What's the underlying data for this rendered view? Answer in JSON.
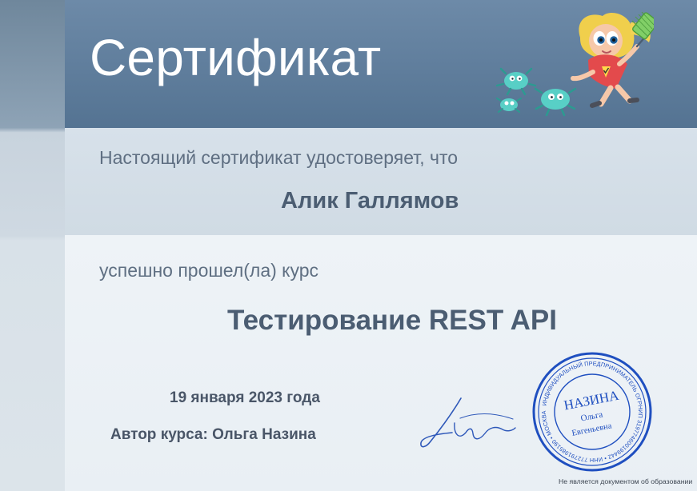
{
  "certificate": {
    "title": "Сертификат",
    "intro": "Настоящий сертификат удостоверяет, что",
    "recipient": "Алик Галлямов",
    "course_intro": "успешно прошел(ла) курс",
    "course_name": "Тестирование REST API",
    "date": "19 января 2023 года",
    "author": "Автор курса: Ольга Назина",
    "disclaimer": "Не является документом об образовании"
  },
  "seal": {
    "name": "НАЗИНА",
    "given_name": "Ольга",
    "patronymic": "Евгеньевна",
    "ring_text": "ИНДИВИДУАЛЬНЫЙ ПРЕДПРИНИМАТЕЛЬ ОГРНИП 319774600199442 • ИНН 772791985190 • МОСКВА"
  },
  "colors": {
    "header": "#5f7f9f",
    "intro_band": "#d3dde6",
    "main_band": "#eef3f7",
    "title": "#ffffff",
    "text": "#4b5d72",
    "seal": "#1f4fc0"
  },
  "icons": {
    "mascot": "girl-with-flyswatter-icon",
    "bugs": "green-bug-icon",
    "seal": "official-stamp-icon",
    "signature": "handwritten-signature-icon"
  }
}
